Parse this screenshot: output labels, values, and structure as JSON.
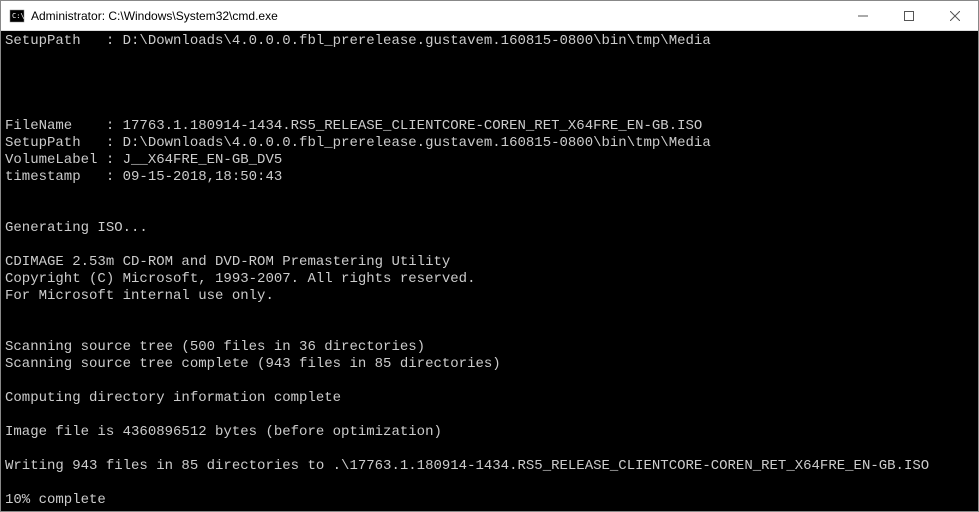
{
  "window": {
    "title": "Administrator: C:\\Windows\\System32\\cmd.exe"
  },
  "terminal": {
    "lines": [
      "SetupPath   : D:\\Downloads\\4.0.0.0.fbl_prerelease.gustavem.160815-0800\\bin\\tmp\\Media",
      "",
      "",
      "",
      "",
      "FileName    : 17763.1.180914-1434.RS5_RELEASE_CLIENTCORE-COREN_RET_X64FRE_EN-GB.ISO",
      "SetupPath   : D:\\Downloads\\4.0.0.0.fbl_prerelease.gustavem.160815-0800\\bin\\tmp\\Media",
      "VolumeLabel : J__X64FRE_EN-GB_DV5",
      "timestamp   : 09-15-2018,18:50:43",
      "",
      "",
      "Generating ISO...",
      "",
      "CDIMAGE 2.53m CD-ROM and DVD-ROM Premastering Utility",
      "Copyright (C) Microsoft, 1993-2007. All rights reserved.",
      "For Microsoft internal use only.",
      "",
      "",
      "Scanning source tree (500 files in 36 directories)",
      "Scanning source tree complete (943 files in 85 directories)",
      "",
      "Computing directory information complete",
      "",
      "Image file is 4360896512 bytes (before optimization)",
      "",
      "Writing 943 files in 85 directories to .\\17763.1.180914-1434.RS5_RELEASE_CLIENTCORE-COREN_RET_X64FRE_EN-GB.ISO",
      "",
      "10% complete"
    ]
  }
}
